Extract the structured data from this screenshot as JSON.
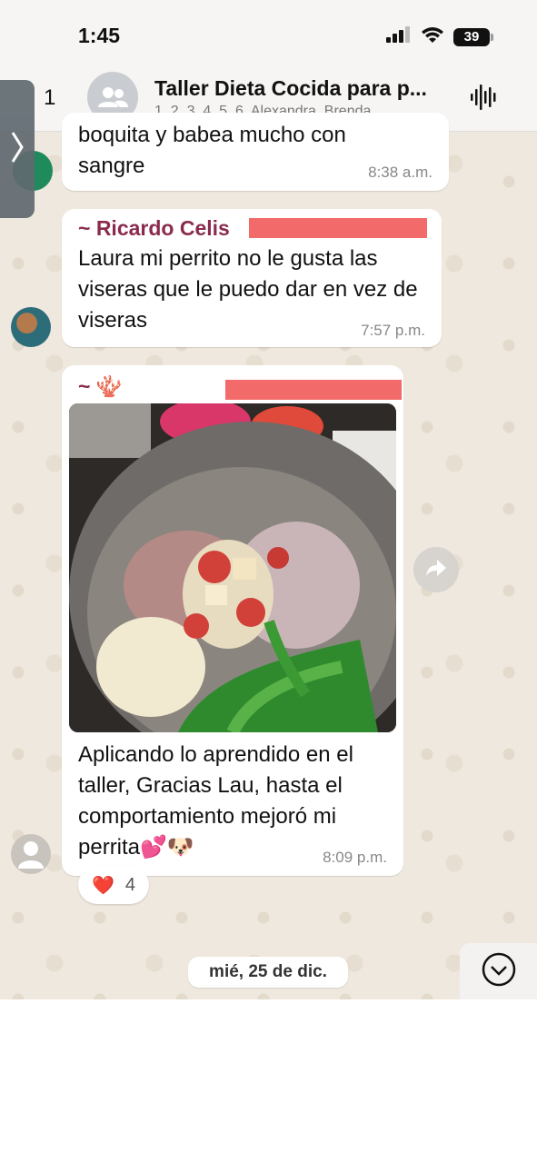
{
  "status_bar": {
    "time": "1:45",
    "battery": "39"
  },
  "header": {
    "back_count": "1",
    "title": "Taller Dieta Cocida para p...",
    "subtitle": "1, 2, 3, 4, 5, 6, Alexandra, Brenda..."
  },
  "messages": [
    {
      "text_line1": "boquita y babea mucho con",
      "text_line2": "sangre",
      "time": "8:38 a.m."
    },
    {
      "sender": "~ Ricardo Celis",
      "text": "Laura mi perrito no le gusta las viseras que le puedo dar en vez de viseras",
      "time": "7:57 p.m."
    },
    {
      "sender": "~ 🪸",
      "caption": "Aplicando lo aprendido en el taller, Gracias Lau, hasta el comportamiento mejoró mi perrita💕🐶",
      "time": "8:09 p.m.",
      "reaction_emoji": "❤️",
      "reaction_count": "4"
    }
  ],
  "date_chip": "mié, 25 de dic.",
  "icons": [
    "signal-icon",
    "wifi-icon",
    "battery-icon",
    "group-avatar-icon",
    "waveform-icon",
    "forward-icon",
    "chevron-down-icon",
    "chevron-right-icon"
  ]
}
